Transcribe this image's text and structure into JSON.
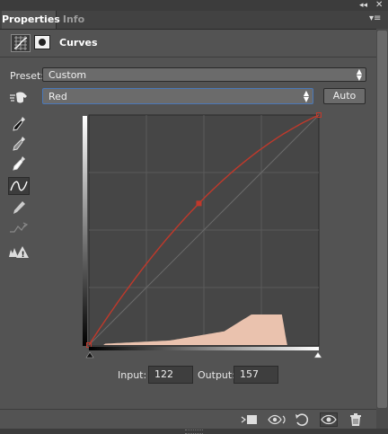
{
  "tabs": [
    {
      "label": "Properties",
      "active": true
    },
    {
      "label": "Info",
      "active": false
    }
  ],
  "panel": {
    "title": "Curves"
  },
  "preset": {
    "label": "Preset:",
    "value": "Custom"
  },
  "channel": {
    "value": "Red",
    "auto_label": "Auto"
  },
  "io": {
    "input_label": "Input:",
    "input_value": "122",
    "output_label": "Output:",
    "output_value": "157"
  },
  "curve": {
    "channel_color": "#c0392b",
    "points": [
      [
        0,
        0
      ],
      [
        122,
        157
      ],
      [
        255,
        255
      ]
    ]
  },
  "icons": {
    "collapse": "double-left-arrow-icon",
    "close": "close-icon",
    "menu": "panel-menu-icon",
    "adjustment": "curves-adjustment-icon",
    "mask": "layer-mask-icon",
    "hand": "on-image-adjust-icon",
    "eyedropper_black": "black-point-eyedropper-icon",
    "eyedropper_gray": "gray-point-eyedropper-icon",
    "eyedropper_white": "white-point-eyedropper-icon",
    "curve_tool": "curve-point-tool-icon",
    "pencil": "pencil-tool-icon",
    "smooth": "smooth-curve-icon",
    "clipping": "clipping-warning-icon",
    "clip_layer": "clip-to-layer-icon",
    "view_previous": "view-previous-state-icon",
    "reset": "reset-icon",
    "visibility": "eye-icon",
    "delete": "trash-icon"
  }
}
